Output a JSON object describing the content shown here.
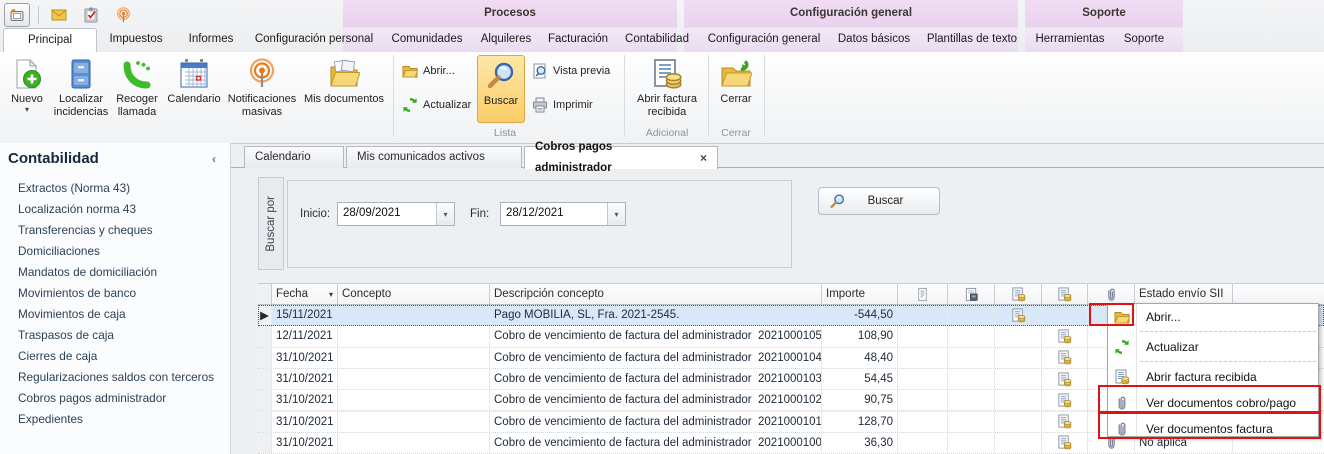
{
  "glyphs": {
    "dropdown": "▾",
    "sort_desc": "▾",
    "row_marker": "▶",
    "tab_close": "×",
    "sidebar_collapse": "‹"
  },
  "quick_access": {
    "icons": [
      "phone-device-icon",
      "mail-icon",
      "tasks-clipboard-icon",
      "broadcast-icon"
    ]
  },
  "ribbon": {
    "context_groups": [
      {
        "label": "Procesos"
      },
      {
        "label": "Configuración general"
      },
      {
        "label": "Soporte"
      }
    ],
    "tabs": [
      {
        "label": "Principal",
        "active": true
      },
      {
        "label": "Impuestos"
      },
      {
        "label": "Informes"
      },
      {
        "label": "Configuración personal"
      },
      {
        "label": "Comunidades",
        "group": "Procesos"
      },
      {
        "label": "Alquileres",
        "group": "Procesos"
      },
      {
        "label": "Facturación",
        "group": "Procesos"
      },
      {
        "label": "Contabilidad",
        "group": "Procesos"
      },
      {
        "label": "Configuración general",
        "group": "Configuración general"
      },
      {
        "label": "Datos básicos",
        "group": "Configuración general"
      },
      {
        "label": "Plantillas de texto",
        "group": "Configuración general"
      },
      {
        "label": "Herramientas",
        "group": "Soporte"
      },
      {
        "label": "Soporte",
        "group": "Soporte"
      }
    ],
    "large_buttons": [
      {
        "label": "Nuevo",
        "icon": "new-document",
        "dropdown": true
      },
      {
        "label": "Localizar incidencias",
        "icon": "file-cabinet"
      },
      {
        "label": "Recoger llamada",
        "icon": "phone-handset"
      },
      {
        "label": "Calendario",
        "icon": "calendar"
      },
      {
        "label": "Notificaciones masivas",
        "icon": "broadcast"
      },
      {
        "label": "Mis documentos",
        "icon": "folder-documents"
      }
    ],
    "lista_group": {
      "label": "Lista",
      "abrir": "Abrir...",
      "actualizar": "Actualizar",
      "buscar": "Buscar",
      "vista_previa": "Vista previa",
      "imprimir": "Imprimir"
    },
    "adicional_group": {
      "label": "Adicional",
      "button": "Abrir factura recibida"
    },
    "cerrar_group": {
      "label": "Cerrar",
      "button": "Cerrar"
    }
  },
  "sidebar": {
    "title": "Contabilidad",
    "items": [
      {
        "label": "Extractos (Norma 43)"
      },
      {
        "label": "Localización norma 43"
      },
      {
        "label": "Transferencias y cheques"
      },
      {
        "label": "Domiciliaciones"
      },
      {
        "label": "Mandatos de domiciliación"
      },
      {
        "label": "Movimientos de banco"
      },
      {
        "label": "Movimientos de caja"
      },
      {
        "label": "Traspasos de caja"
      },
      {
        "label": "Cierres de caja"
      },
      {
        "label": "Regularizaciones saldos con terceros"
      },
      {
        "label": "Cobros pagos administrador"
      },
      {
        "label": "Expedientes"
      }
    ]
  },
  "doc_tabs": [
    {
      "label": "Calendario"
    },
    {
      "label": "Mis comunicados activos"
    },
    {
      "label": "Cobros pagos administrador",
      "active": true,
      "closable": true
    }
  ],
  "search": {
    "panel_label": "Buscar por",
    "inicio_label": "Inicio:",
    "inicio_value": "28/09/2021",
    "fin_label": "Fin:",
    "fin_value": "28/12/2021",
    "button": "Buscar"
  },
  "table": {
    "headers": {
      "fecha": "Fecha",
      "concepto": "Concepto",
      "descripcion": "Descripción concepto",
      "importe": "Importe",
      "estado": "Estado envío SII"
    },
    "icon_columns": [
      "receipt-icon",
      "document-save-icon",
      "invoice-coins-icon",
      "invoice-coins-icon",
      "paperclip-icon"
    ],
    "rows": [
      {
        "fecha": "15/11/2021",
        "concepto": "",
        "descripcion": "Pago MOBILIA, SL, Fra. 2021-2545.",
        "importe": "-544,50",
        "estado": "",
        "selected": true,
        "attachment": true
      },
      {
        "fecha": "12/11/2021",
        "concepto": "",
        "descripcion": "Cobro de vencimiento de factura del administrador  2021000105.",
        "importe": "108,90",
        "estado": "",
        "attachment": true
      },
      {
        "fecha": "31/10/2021",
        "concepto": "",
        "descripcion": "Cobro de vencimiento de factura del administrador  2021000104.",
        "importe": "48,40",
        "estado": "",
        "attachment": true
      },
      {
        "fecha": "31/10/2021",
        "concepto": "",
        "descripcion": "Cobro de vencimiento de factura del administrador  2021000103.",
        "importe": "54,45",
        "estado": "",
        "attachment": true
      },
      {
        "fecha": "31/10/2021",
        "concepto": "",
        "descripcion": "Cobro de vencimiento de factura del administrador  2021000102.",
        "importe": "90,75",
        "estado": "",
        "attachment": true
      },
      {
        "fecha": "31/10/2021",
        "concepto": "",
        "descripcion": "Cobro de vencimiento de factura del administrador  2021000101.",
        "importe": "128,70",
        "estado": "",
        "attachment": true
      },
      {
        "fecha": "31/10/2021",
        "concepto": "",
        "descripcion": "Cobro de vencimiento de factura del administrador  2021000100.",
        "importe": "36,30",
        "estado": "No aplica",
        "attachment": true
      }
    ]
  },
  "context_menu": {
    "items": [
      {
        "label": "Abrir...",
        "icon": "folder-open-icon"
      },
      {
        "label": "Actualizar",
        "icon": "refresh-icon"
      },
      {
        "label": "Abrir factura recibida",
        "icon": "invoice-coins-icon"
      },
      {
        "label": "Ver documentos cobro/pago",
        "icon": "paperclip-icon",
        "highlighted": true
      },
      {
        "label": "Ver documentos factura",
        "icon": "paperclip-icon",
        "highlighted": true
      }
    ]
  },
  "colors": {
    "highlight_red": "#e01212",
    "selection_blue": "#d9e8f8",
    "pressed_button_orange": "#fbd36b",
    "context_band_lavender": "#ecd9f0"
  }
}
